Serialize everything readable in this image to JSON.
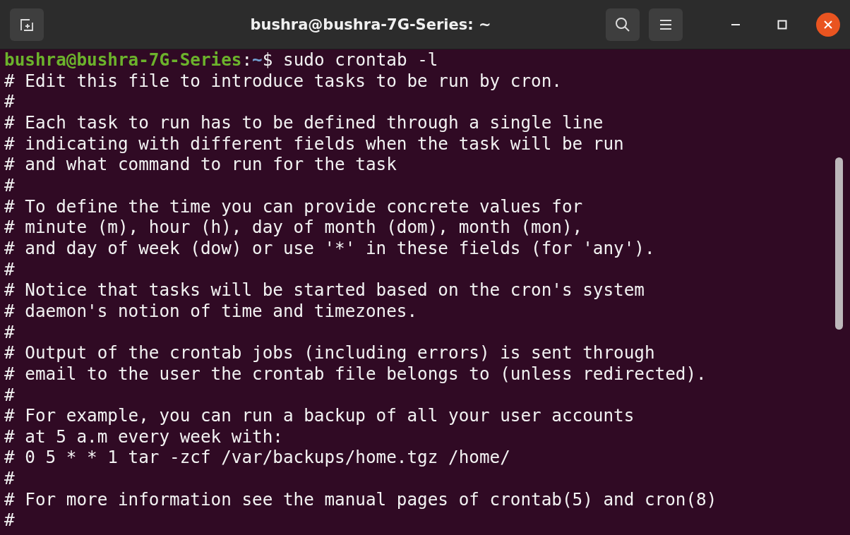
{
  "window": {
    "title": "bushra@bushra-7G-Series: ~"
  },
  "prompt": {
    "user_host": "bushra@bushra-7G-Series",
    "separator": ":",
    "path": "~",
    "symbol": "$",
    "command": "sudo crontab -l"
  },
  "output": [
    "# Edit this file to introduce tasks to be run by cron.",
    "#",
    "# Each task to run has to be defined through a single line",
    "# indicating with different fields when the task will be run",
    "# and what command to run for the task",
    "#",
    "# To define the time you can provide concrete values for",
    "# minute (m), hour (h), day of month (dom), month (mon),",
    "# and day of week (dow) or use '*' in these fields (for 'any').",
    "#",
    "# Notice that tasks will be started based on the cron's system",
    "# daemon's notion of time and timezones.",
    "#",
    "# Output of the crontab jobs (including errors) is sent through",
    "# email to the user the crontab file belongs to (unless redirected).",
    "#",
    "# For example, you can run a backup of all your user accounts",
    "# at 5 a.m every week with:",
    "# 0 5 * * 1 tar -zcf /var/backups/home.tgz /home/",
    "#",
    "# For more information see the manual pages of crontab(5) and cron(8)",
    "#"
  ]
}
